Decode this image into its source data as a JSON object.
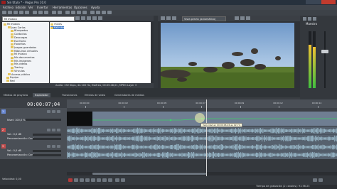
{
  "window": {
    "title": "Sin título * - Vegas Pro 10.0"
  },
  "menu": [
    "Archivo",
    "Edición",
    "Ver",
    "Insertar",
    "Herramientas",
    "Opciones",
    "Ayuda"
  ],
  "explorer": {
    "path": "Mi música",
    "tree": [
      "Mi música",
      "Juan Carlos",
      "Búsquedas",
      "Contactos",
      "Descargas",
      "Escritorio",
      "Favoritos",
      "Juegos guardados",
      "Máquinas virtuales",
      "Mi música",
      "Mis documentos",
      "Mis imágenes",
      "Mis vídeos",
      "Tracing",
      "Vínculos",
      "Acceso público",
      "Equipo",
      "Red"
    ],
    "files": [
      {
        "name": "iTunes",
        "selected": false
      },
      {
        "name": "Kalimba",
        "selected": true
      }
    ],
    "status": "Audio: 192 Kbps, 44.100 Hz, Estéreo, 00:05:48,01, MPEG Layer 3"
  },
  "tabs": [
    {
      "label": "Medios de proyecto",
      "active": false
    },
    {
      "label": "Explorador",
      "active": true
    },
    {
      "label": "Transiciones",
      "active": false
    },
    {
      "label": "Efectos de vídeo",
      "active": false
    },
    {
      "label": "Generadores de medios",
      "active": false
    }
  ],
  "preview": {
    "mode": "Vista previa (automático)",
    "project": "Proyecto: 720x480x32, 29,970",
    "preview_res": "Vista previa: 360x240x32, 29,970",
    "frame": "Fotograma: 211",
    "display": "Pantalla: 348x232x32"
  },
  "mixer": {
    "master": "Maestro",
    "levels": [
      0.76,
      0.72
    ]
  },
  "timeline": {
    "timecode": "00:00:07;04",
    "ruler": [
      "00:00:00",
      "00:00:02",
      "00:00:05",
      "00:00:07",
      "00:00:09",
      "00:00:12",
      "00:00:14"
    ],
    "tooltip": "Velocidad en 00:00:06;24 es 121 %",
    "tracks": [
      {
        "number": "1",
        "type": "video",
        "label": "Nivel: 100,0 %"
      },
      {
        "number": "2",
        "type": "audio",
        "label": "Vol.: 0,0 dB",
        "sublabel": "Panoramización: Centro"
      },
      {
        "number": "3",
        "type": "audio",
        "label": "Vol.: 0,0 dB",
        "sublabel": "Panoramización: Centro"
      }
    ]
  },
  "bottom": {
    "rate": "Velocidad: 0,00",
    "status": "Tiempo de grabación (2 canales): 91:56:23"
  }
}
